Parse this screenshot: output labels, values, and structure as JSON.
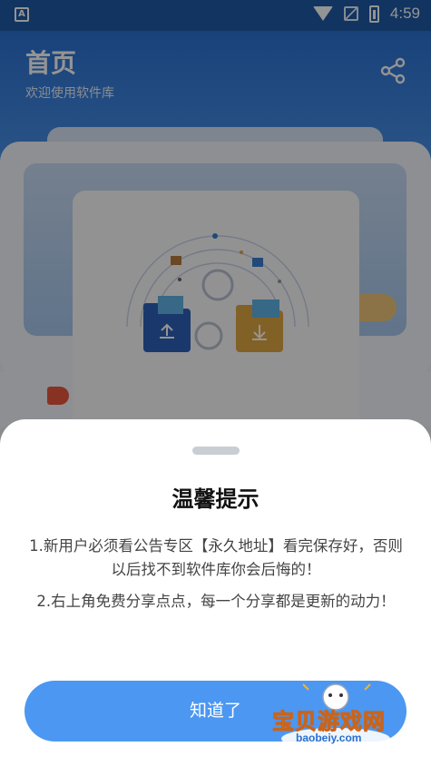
{
  "status_bar": {
    "time": "4:59"
  },
  "header": {
    "title": "首页",
    "subtitle": "欢迎使用软件库"
  },
  "dialog": {
    "title": "温馨提示",
    "tip1": "1.新用户必须看公告专区【永久地址】看完保存好，否则以后找不到软件库你会后悔的！",
    "tip2": "2.右上角免费分享点点，每一个分享都是更新的动力！",
    "confirm_label": "知道了"
  },
  "watermark": {
    "brand": "宝贝游戏网",
    "url": "baobeiy.com"
  }
}
